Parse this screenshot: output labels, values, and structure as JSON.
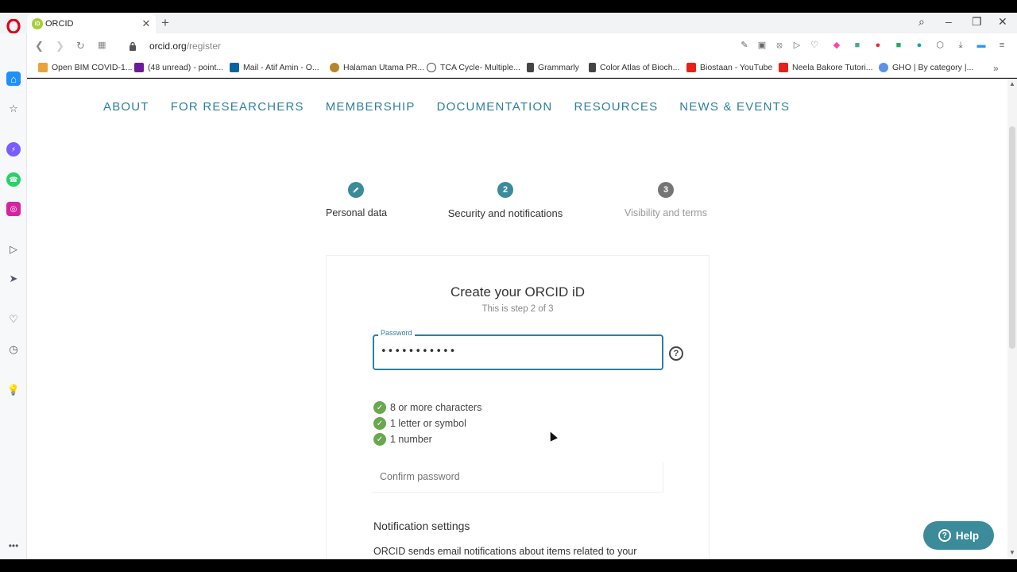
{
  "browser": {
    "tab_title": "ORCID",
    "tab_favicon": "iD",
    "url_host": "orcid.org",
    "url_path": "/register",
    "bookmarks": [
      {
        "label": "Open BIM COVID-1...",
        "color": "#e8a33b"
      },
      {
        "label": "(48 unread) - point...",
        "color": "#6a1b9a"
      },
      {
        "label": "Mail - Atif Amin - O...",
        "color": "#0a64a4"
      },
      {
        "label": "Halaman Utama PR...",
        "color": "#b7862b"
      },
      {
        "label": "TCA Cycle- Multiple...",
        "color": "#555555"
      },
      {
        "label": "Grammarly",
        "color": "#444444"
      },
      {
        "label": "Color Atlas of Bioch...",
        "color": "#444444"
      },
      {
        "label": "Biostaan - YouTube",
        "color": "#e62117"
      },
      {
        "label": "Neela Bakore Tutori...",
        "color": "#e62117"
      },
      {
        "label": "GHO | By category |...",
        "color": "#5b92e5"
      }
    ]
  },
  "nav": {
    "items": [
      "ABOUT",
      "FOR RESEARCHERS",
      "MEMBERSHIP",
      "DOCUMENTATION",
      "RESOURCES",
      "NEWS & EVENTS"
    ]
  },
  "stepper": {
    "steps": [
      {
        "icon": "pencil-icon",
        "label": "Personal data",
        "state": "done",
        "color": "#3b8b9b"
      },
      {
        "number": "2",
        "label": "Security and notifications",
        "state": "active",
        "color": "#3b8b9b"
      },
      {
        "number": "3",
        "label": "Visibility and terms",
        "state": "pending",
        "color": "#757575"
      }
    ]
  },
  "form": {
    "title": "Create your ORCID iD",
    "subtitle": "This is step 2 of 3",
    "password_label": "Password",
    "password_value": "•••••••••••",
    "requirements": [
      "8 or more characters",
      "1 letter or symbol",
      "1 number"
    ],
    "confirm_placeholder": "Confirm password",
    "notification_title": "Notification settings",
    "notification_text": "ORCID sends email notifications about items related to your"
  },
  "help_button": {
    "label": "Help"
  },
  "colors": {
    "accent": "#2e7f9f",
    "check": "#6aa84f",
    "help_bg": "#3b8b9b"
  }
}
